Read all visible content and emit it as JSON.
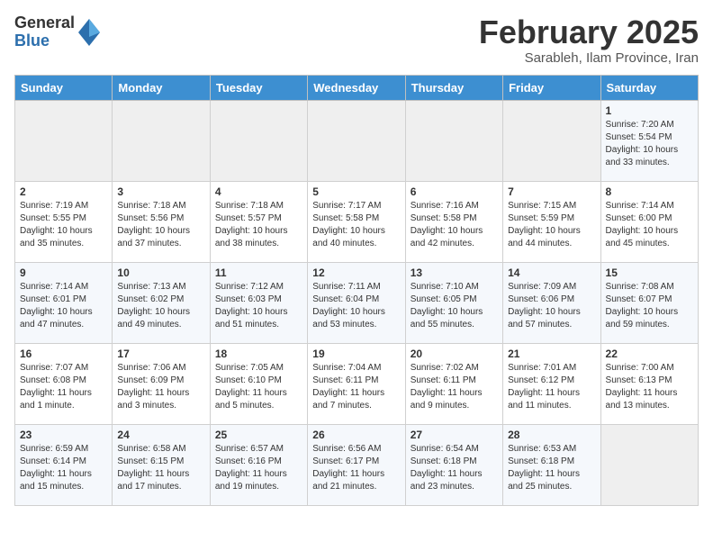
{
  "header": {
    "logo": {
      "general": "General",
      "blue": "Blue"
    },
    "month": "February 2025",
    "location": "Sarableh, Ilam Province, Iran"
  },
  "weekdays": [
    "Sunday",
    "Monday",
    "Tuesday",
    "Wednesday",
    "Thursday",
    "Friday",
    "Saturday"
  ],
  "weeks": [
    [
      {
        "num": "",
        "info": ""
      },
      {
        "num": "",
        "info": ""
      },
      {
        "num": "",
        "info": ""
      },
      {
        "num": "",
        "info": ""
      },
      {
        "num": "",
        "info": ""
      },
      {
        "num": "",
        "info": ""
      },
      {
        "num": "1",
        "info": "Sunrise: 7:20 AM\nSunset: 5:54 PM\nDaylight: 10 hours\nand 33 minutes."
      }
    ],
    [
      {
        "num": "2",
        "info": "Sunrise: 7:19 AM\nSunset: 5:55 PM\nDaylight: 10 hours\nand 35 minutes."
      },
      {
        "num": "3",
        "info": "Sunrise: 7:18 AM\nSunset: 5:56 PM\nDaylight: 10 hours\nand 37 minutes."
      },
      {
        "num": "4",
        "info": "Sunrise: 7:18 AM\nSunset: 5:57 PM\nDaylight: 10 hours\nand 38 minutes."
      },
      {
        "num": "5",
        "info": "Sunrise: 7:17 AM\nSunset: 5:58 PM\nDaylight: 10 hours\nand 40 minutes."
      },
      {
        "num": "6",
        "info": "Sunrise: 7:16 AM\nSunset: 5:58 PM\nDaylight: 10 hours\nand 42 minutes."
      },
      {
        "num": "7",
        "info": "Sunrise: 7:15 AM\nSunset: 5:59 PM\nDaylight: 10 hours\nand 44 minutes."
      },
      {
        "num": "8",
        "info": "Sunrise: 7:14 AM\nSunset: 6:00 PM\nDaylight: 10 hours\nand 45 minutes."
      }
    ],
    [
      {
        "num": "9",
        "info": "Sunrise: 7:14 AM\nSunset: 6:01 PM\nDaylight: 10 hours\nand 47 minutes."
      },
      {
        "num": "10",
        "info": "Sunrise: 7:13 AM\nSunset: 6:02 PM\nDaylight: 10 hours\nand 49 minutes."
      },
      {
        "num": "11",
        "info": "Sunrise: 7:12 AM\nSunset: 6:03 PM\nDaylight: 10 hours\nand 51 minutes."
      },
      {
        "num": "12",
        "info": "Sunrise: 7:11 AM\nSunset: 6:04 PM\nDaylight: 10 hours\nand 53 minutes."
      },
      {
        "num": "13",
        "info": "Sunrise: 7:10 AM\nSunset: 6:05 PM\nDaylight: 10 hours\nand 55 minutes."
      },
      {
        "num": "14",
        "info": "Sunrise: 7:09 AM\nSunset: 6:06 PM\nDaylight: 10 hours\nand 57 minutes."
      },
      {
        "num": "15",
        "info": "Sunrise: 7:08 AM\nSunset: 6:07 PM\nDaylight: 10 hours\nand 59 minutes."
      }
    ],
    [
      {
        "num": "16",
        "info": "Sunrise: 7:07 AM\nSunset: 6:08 PM\nDaylight: 11 hours\nand 1 minute."
      },
      {
        "num": "17",
        "info": "Sunrise: 7:06 AM\nSunset: 6:09 PM\nDaylight: 11 hours\nand 3 minutes."
      },
      {
        "num": "18",
        "info": "Sunrise: 7:05 AM\nSunset: 6:10 PM\nDaylight: 11 hours\nand 5 minutes."
      },
      {
        "num": "19",
        "info": "Sunrise: 7:04 AM\nSunset: 6:11 PM\nDaylight: 11 hours\nand 7 minutes."
      },
      {
        "num": "20",
        "info": "Sunrise: 7:02 AM\nSunset: 6:11 PM\nDaylight: 11 hours\nand 9 minutes."
      },
      {
        "num": "21",
        "info": "Sunrise: 7:01 AM\nSunset: 6:12 PM\nDaylight: 11 hours\nand 11 minutes."
      },
      {
        "num": "22",
        "info": "Sunrise: 7:00 AM\nSunset: 6:13 PM\nDaylight: 11 hours\nand 13 minutes."
      }
    ],
    [
      {
        "num": "23",
        "info": "Sunrise: 6:59 AM\nSunset: 6:14 PM\nDaylight: 11 hours\nand 15 minutes."
      },
      {
        "num": "24",
        "info": "Sunrise: 6:58 AM\nSunset: 6:15 PM\nDaylight: 11 hours\nand 17 minutes."
      },
      {
        "num": "25",
        "info": "Sunrise: 6:57 AM\nSunset: 6:16 PM\nDaylight: 11 hours\nand 19 minutes."
      },
      {
        "num": "26",
        "info": "Sunrise: 6:56 AM\nSunset: 6:17 PM\nDaylight: 11 hours\nand 21 minutes."
      },
      {
        "num": "27",
        "info": "Sunrise: 6:54 AM\nSunset: 6:18 PM\nDaylight: 11 hours\nand 23 minutes."
      },
      {
        "num": "28",
        "info": "Sunrise: 6:53 AM\nSunset: 6:18 PM\nDaylight: 11 hours\nand 25 minutes."
      },
      {
        "num": "",
        "info": ""
      }
    ]
  ]
}
